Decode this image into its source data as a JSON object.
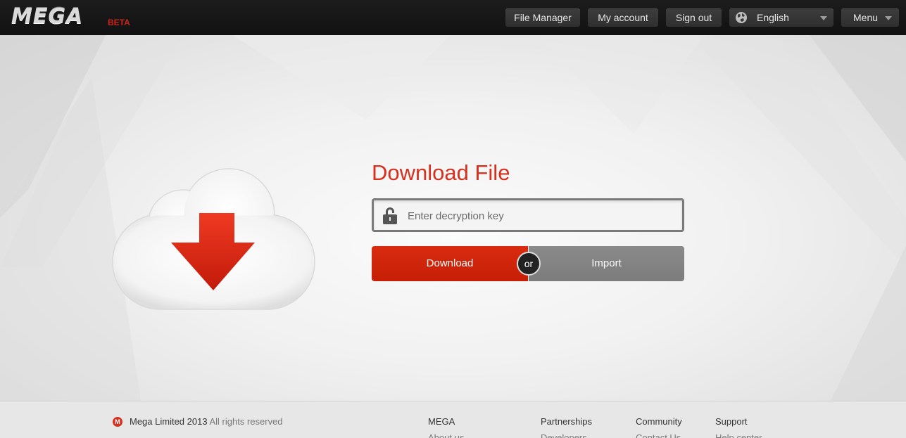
{
  "header": {
    "logo_text": "MEGA",
    "beta_label": "BETA",
    "file_manager_label": "File Manager",
    "my_account_label": "My account",
    "sign_out_label": "Sign out",
    "language_label": "English",
    "menu_label": "Menu"
  },
  "main": {
    "title": "Download File",
    "key_placeholder": "Enter decryption key",
    "download_label": "Download",
    "or_label": "or",
    "import_label": "Import"
  },
  "footer": {
    "company": "Mega Limited 2013",
    "rights": "All rights reserved",
    "logo_letter": "M",
    "columns": [
      {
        "title": "MEGA",
        "sub": "About us"
      },
      {
        "title": "Partnerships",
        "sub": "Developers"
      },
      {
        "title": "Community",
        "sub": "Contact Us"
      },
      {
        "title": "Support",
        "sub": "Help center"
      }
    ]
  },
  "colors": {
    "accent_red": "#d7301f",
    "download_red": "#c51f06",
    "import_gray": "#7c7c7c",
    "topbar": "#111111"
  },
  "icons": [
    "globe-icon",
    "caret-down-icon",
    "lock-icon",
    "cloud-download-icon",
    "mega-logo-icon"
  ]
}
